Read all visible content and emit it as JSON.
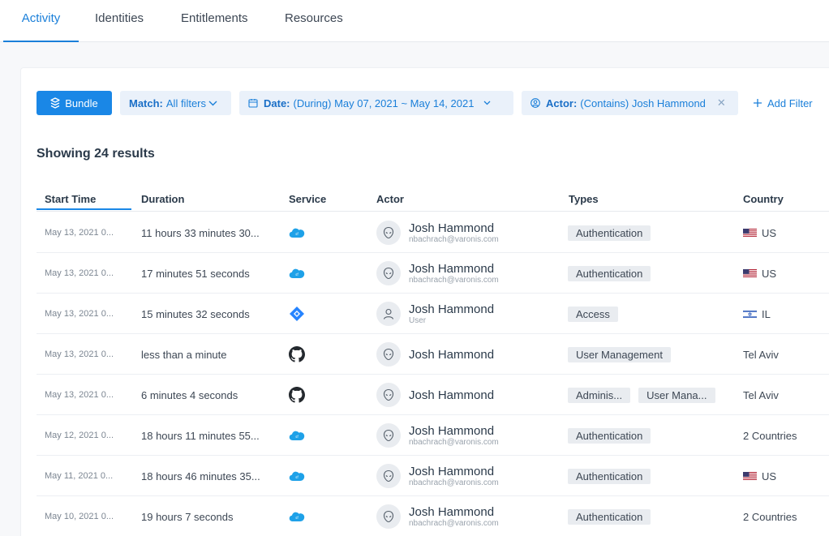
{
  "tabs": [
    {
      "label": "Activity",
      "active": true
    },
    {
      "label": "Identities",
      "active": false
    },
    {
      "label": "Entitlements",
      "active": false
    },
    {
      "label": "Resources",
      "active": false
    }
  ],
  "filters": {
    "bundle_label": "Bundle",
    "match": {
      "key": "Match:",
      "value": "All filters"
    },
    "date": {
      "key": "Date:",
      "value": "(During) May 07, 2021 ~ May 14, 2021"
    },
    "actor": {
      "key": "Actor:",
      "value": "(Contains) Josh Hammond"
    },
    "add_filter_label": "Add Filter"
  },
  "results_title": "Showing 24 results",
  "table": {
    "columns": [
      "Start Time",
      "Duration",
      "Service",
      "Actor",
      "Types",
      "Country"
    ],
    "rows": [
      {
        "start": "May 13, 2021 0...",
        "duration": "11 hours 33 minutes 30...",
        "service": "salesforce-icon",
        "actor": "Josh Hammond",
        "actor_sub": "nbachrach@varonis.com",
        "avatar": "alien-icon",
        "types": [
          "Authentication"
        ],
        "country": "US",
        "flag": "us"
      },
      {
        "start": "May 13, 2021 0...",
        "duration": "17 minutes 51 seconds",
        "service": "salesforce-icon",
        "actor": "Josh Hammond",
        "actor_sub": "nbachrach@varonis.com",
        "avatar": "alien-icon",
        "types": [
          "Authentication"
        ],
        "country": "US",
        "flag": "us"
      },
      {
        "start": "May 13, 2021 0...",
        "duration": "15 minutes 32 seconds",
        "service": "jira-icon",
        "actor": "Josh Hammond",
        "actor_sub": "User",
        "avatar": "user-icon",
        "types": [
          "Access"
        ],
        "country": "IL",
        "flag": "il"
      },
      {
        "start": "May 13, 2021 0...",
        "duration": "less than a minute",
        "service": "github-icon",
        "actor": "Josh Hammond",
        "actor_sub": "",
        "avatar": "alien-icon",
        "types": [
          "User Management"
        ],
        "country": "Tel Aviv",
        "flag": ""
      },
      {
        "start": "May 13, 2021 0...",
        "duration": "6 minutes 4 seconds",
        "service": "github-icon",
        "actor": "Josh Hammond",
        "actor_sub": "",
        "avatar": "alien-icon",
        "types": [
          "Adminis...",
          "User Mana..."
        ],
        "country": "Tel Aviv",
        "flag": ""
      },
      {
        "start": "May 12, 2021 0...",
        "duration": "18 hours 11 minutes 55...",
        "service": "salesforce-icon",
        "actor": "Josh Hammond",
        "actor_sub": "nbachrach@varonis.com",
        "avatar": "alien-icon",
        "types": [
          "Authentication"
        ],
        "country": "2 Countries",
        "flag": ""
      },
      {
        "start": "May 11, 2021 0...",
        "duration": "18 hours 46 minutes 35...",
        "service": "salesforce-icon",
        "actor": "Josh Hammond",
        "actor_sub": "nbachrach@varonis.com",
        "avatar": "alien-icon",
        "types": [
          "Authentication"
        ],
        "country": "US",
        "flag": "us"
      },
      {
        "start": "May 10, 2021 0...",
        "duration": "19 hours 7 seconds",
        "service": "salesforce-icon",
        "actor": "Josh Hammond",
        "actor_sub": "nbachrach@varonis.com",
        "avatar": "alien-icon",
        "types": [
          "Authentication"
        ],
        "country": "2 Countries",
        "flag": ""
      }
    ]
  },
  "colors": {
    "accent": "#1a87e6",
    "chip_bg": "#eaf1fa",
    "tag_bg": "#e9ecf0",
    "salesforce": "#1ea1e8",
    "jira": "#2684ff",
    "github": "#24292e"
  }
}
